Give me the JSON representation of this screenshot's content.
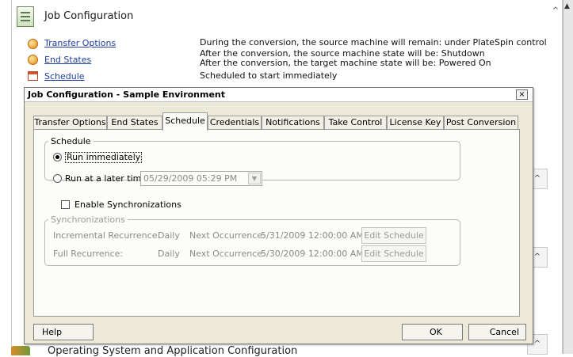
{
  "background": {
    "header_title": "Job Configuration",
    "options": [
      {
        "link": "Transfer Options",
        "description": "During the conversion, the source machine will remain: under PlateSpin control"
      },
      {
        "link": "End States",
        "description": "After the conversion, the source machine state will be: Shutdown",
        "description2": "After the conversion, the target machine state will be: Powered On"
      },
      {
        "link": "Schedule",
        "description": "Scheduled to start immediately"
      }
    ],
    "footer_text": "Operating System and Application Configuration"
  },
  "dialog": {
    "title": "Job Configuration - Sample Environment",
    "close_glyph": "×",
    "tabs": [
      "Transfer Options",
      "End States",
      "Schedule",
      "Credentials",
      "Notifications",
      "Take Control",
      "License Key",
      "Post Conversion"
    ],
    "active_tab": "Schedule",
    "schedule": {
      "group_label": "Schedule",
      "run_immediately": "Run immediately",
      "run_later": "Run at a later time",
      "selected": "Run immediately",
      "date_value": "05/29/2009 05:29 PM"
    },
    "enable_sync_label": "Enable Synchronizations",
    "enable_sync_checked": false,
    "sync": {
      "group_label": "Synchronizations",
      "rows": [
        {
          "label": "Incremental Recurrence:",
          "frequency": "Daily",
          "next_label": "Next Occurrence:",
          "next_value": "5/31/2009 12:00:00 AM",
          "button": "Edit Schedule"
        },
        {
          "label": "Full Recurrence:",
          "frequency": "Daily",
          "next_label": "Next Occurrence:",
          "next_value": "5/30/2009 12:00:00 AM",
          "button": "Edit Schedule"
        }
      ]
    },
    "buttons": {
      "help": "Help",
      "ok": "OK",
      "cancel": "Cancel"
    }
  },
  "icons": {
    "expand_up": "^"
  }
}
